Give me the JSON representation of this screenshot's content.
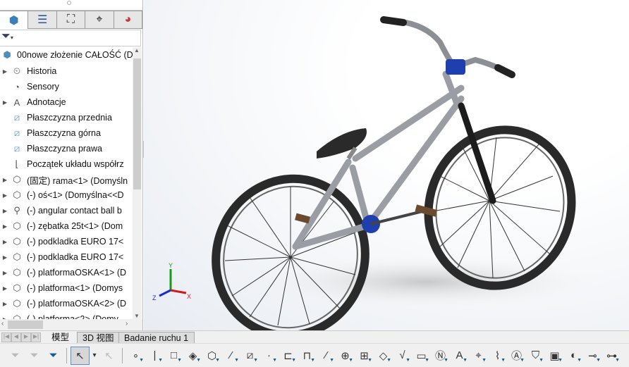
{
  "panel_tabs": [
    {
      "name": "feature-manager",
      "icon": "assembly-icon",
      "glyph": "⬢"
    },
    {
      "name": "property-manager",
      "icon": "property-list-icon",
      "glyph": "☰"
    },
    {
      "name": "configuration-manager",
      "icon": "configuration-icon",
      "glyph": "⛶"
    },
    {
      "name": "dimxpert-manager",
      "icon": "crosshair-icon",
      "glyph": "⌖"
    },
    {
      "name": "display-manager",
      "icon": "color-wheel-icon",
      "glyph": "◕"
    }
  ],
  "filter_icon": "funnel-icon",
  "tree": {
    "root": "00nowe złożenie CAŁOŚĆ  (D",
    "items": [
      {
        "label": "Historia",
        "icon": "history-folder-icon",
        "glyph": "⏲",
        "expandable": true
      },
      {
        "label": "Sensory",
        "icon": "sensors-folder-icon",
        "glyph": "◔",
        "expandable": false
      },
      {
        "label": "Adnotacje",
        "icon": "annotations-folder-icon",
        "glyph": "A",
        "expandable": true
      },
      {
        "label": "Płaszczyzna przednia",
        "icon": "plane-icon",
        "glyph": "⧄",
        "expandable": false
      },
      {
        "label": "Płaszczyzna górna",
        "icon": "plane-icon",
        "glyph": "⧄",
        "expandable": false
      },
      {
        "label": "Płaszczyzna prawa",
        "icon": "plane-icon",
        "glyph": "⧄",
        "expandable": false
      },
      {
        "label": "Początek układu współrz",
        "icon": "origin-icon",
        "glyph": "⌊",
        "expandable": false
      },
      {
        "label": "(固定) rama<1> (Domyśln",
        "icon": "part-icon",
        "glyph": "⬡",
        "expandable": true
      },
      {
        "label": "(-) oś<1> (Domyślna<<D",
        "icon": "part-icon",
        "glyph": "⬡",
        "expandable": true
      },
      {
        "label": "(-) angular contact ball b",
        "icon": "toolbox-part-icon",
        "glyph": "⚲",
        "expandable": true
      },
      {
        "label": "(-) zębatka 25t<1> (Dom",
        "icon": "part-icon",
        "glyph": "⬡",
        "expandable": true
      },
      {
        "label": "(-) podkladka EURO 17<",
        "icon": "part-icon",
        "glyph": "⬡",
        "expandable": true
      },
      {
        "label": "(-) podkladka EURO 17<",
        "icon": "part-icon",
        "glyph": "⬡",
        "expandable": true
      },
      {
        "label": "(-) platformaOSKA<1> (D",
        "icon": "part-icon",
        "glyph": "⬡",
        "expandable": true
      },
      {
        "label": "(-) platforma<1> (Domys",
        "icon": "part-icon",
        "glyph": "⬡",
        "expandable": true
      },
      {
        "label": "(-) platformaOSKA<2> (D",
        "icon": "part-icon",
        "glyph": "⬡",
        "expandable": true
      },
      {
        "label": "(-) platforma<2> (Domy",
        "icon": "part-icon",
        "glyph": "⬡",
        "expandable": true
      }
    ]
  },
  "bottom_tabs": [
    "模型",
    "3D 视图",
    "Badanie ruchu 1"
  ],
  "active_bottom_tab": "模型",
  "triad": {
    "x": "X",
    "y": "Y",
    "z": "Z"
  },
  "toolbar": [
    {
      "icon": "filter-icon",
      "glyph": "⏷",
      "disabled": true
    },
    {
      "icon": "filter-multiple-icon",
      "glyph": "⏷",
      "disabled": true
    },
    {
      "icon": "filter-toggle-icon",
      "glyph": "⏷",
      "disabled": false
    },
    {
      "icon": "select-arrow-icon",
      "glyph": "↖",
      "selected": true
    },
    {
      "icon": "dropdown-icon",
      "glyph": "▾"
    },
    {
      "icon": "select-other-icon",
      "glyph": "↖",
      "disabled": true
    },
    {
      "icon": "filter-vertices-icon",
      "glyph": "∘"
    },
    {
      "icon": "filter-edges-icon",
      "glyph": "|"
    },
    {
      "icon": "filter-faces-icon",
      "glyph": "□"
    },
    {
      "icon": "filter-surface-bodies-icon",
      "glyph": "◈"
    },
    {
      "icon": "filter-solid-bodies-icon",
      "glyph": "⬡"
    },
    {
      "icon": "filter-axes-icon",
      "glyph": "⁄"
    },
    {
      "icon": "filter-planes-icon",
      "glyph": "⧄"
    },
    {
      "icon": "filter-sketch-points-icon",
      "glyph": "·"
    },
    {
      "icon": "filter-sketch-segments-icon",
      "glyph": "⊏"
    },
    {
      "icon": "filter-midpoints-icon",
      "glyph": "⊓"
    },
    {
      "icon": "filter-center-marks-icon",
      "glyph": "⁄"
    },
    {
      "icon": "filter-centerline-icon",
      "glyph": "⊕"
    },
    {
      "icon": "filter-dimensions-icon",
      "glyph": "⊞"
    },
    {
      "icon": "filter-surface-finish-icon",
      "glyph": "◇"
    },
    {
      "icon": "filter-geometric-tolerance-icon",
      "glyph": "√"
    },
    {
      "icon": "filter-notes-icon",
      "glyph": "▭"
    },
    {
      "icon": "filter-balloons-icon",
      "glyph": "Ⓝ"
    },
    {
      "icon": "filter-weld-symbols-icon",
      "glyph": "A"
    },
    {
      "icon": "filter-datum-targets-icon",
      "glyph": "⌖"
    },
    {
      "icon": "filter-cosmetic-threads-icon",
      "glyph": "⌇"
    },
    {
      "icon": "filter-datum-features-icon",
      "glyph": "Ⓐ"
    },
    {
      "icon": "filter-dowel-pins-icon",
      "glyph": "⛉"
    },
    {
      "icon": "filter-blocks-icon",
      "glyph": "▣"
    },
    {
      "icon": "filter-connection-points-icon",
      "glyph": "◐"
    },
    {
      "icon": "filter-routing-points-icon",
      "glyph": "⊸"
    },
    {
      "icon": "filter-mesh-icon",
      "glyph": "⊶"
    }
  ]
}
